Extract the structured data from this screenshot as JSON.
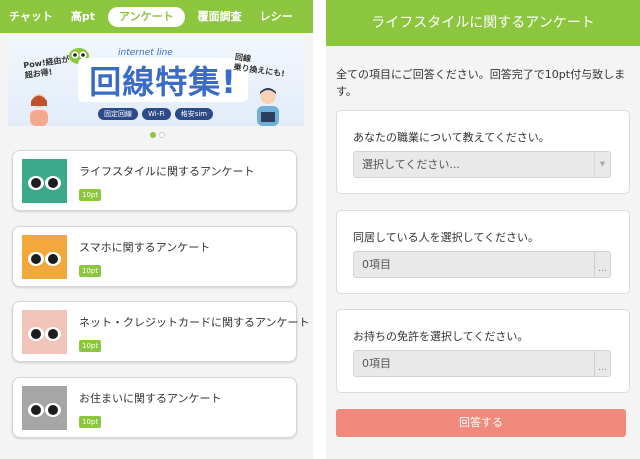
{
  "tabs": [
    {
      "label": "チャット"
    },
    {
      "label": "高pt"
    },
    {
      "label": "アンケート"
    },
    {
      "label": "覆面調査"
    },
    {
      "label": "レシー"
    }
  ],
  "banner": {
    "subtitle": "internet line",
    "title": "回線特集!",
    "left_text": "Pow!経由が\n超お得!",
    "right_text": "回線\n乗り換えにも!",
    "chips": [
      "固定回線",
      "Wi-Fi",
      "格安sim"
    ]
  },
  "surveys": [
    {
      "title": "ライフスタイルに関するアンケート",
      "points": "10pt",
      "color": "#3aaa8a"
    },
    {
      "title": "スマホに関するアンケート",
      "points": "10pt",
      "color": "#f3a83b"
    },
    {
      "title": "ネット・クレジットカードに関するアンケート",
      "points": "10pt",
      "color": "#f1c4b9"
    },
    {
      "title": "お住まいに関するアンケート",
      "points": "10pt",
      "color": "#a6a6a6"
    }
  ],
  "form": {
    "header": "ライフスタイルに関するアンケート",
    "intro": "全ての項目にご回答ください。回答完了で10pt付与致します。",
    "questions": [
      {
        "label": "あなたの職業について教えてください。",
        "value": "選択してください..."
      },
      {
        "label": "同居している人を選択してください。",
        "value": "0項目"
      },
      {
        "label": "お持ちの免許を選択してください。",
        "value": "0項目"
      }
    ],
    "submit": "回答する"
  },
  "colors": {
    "accent": "#8cc63f",
    "submit": "#f08a7c"
  }
}
